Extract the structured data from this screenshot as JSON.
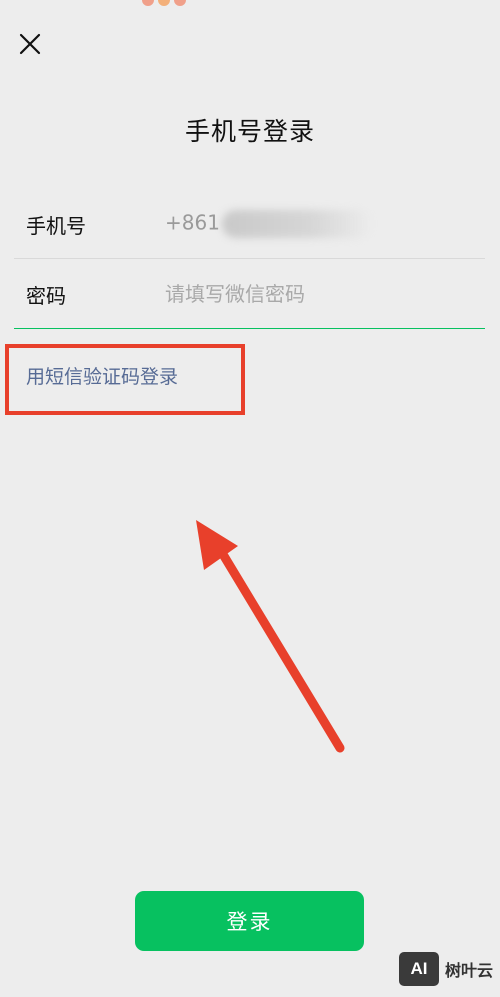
{
  "header": {
    "title": "手机号登录"
  },
  "form": {
    "phone_label": "手机号",
    "phone_value": "+861",
    "password_label": "密码",
    "password_placeholder": "请填写微信密码"
  },
  "links": {
    "sms_login": "用短信验证码登录"
  },
  "actions": {
    "login_label": "登录"
  },
  "watermark": {
    "logo_text": "AI",
    "brand": "树叶云"
  },
  "colors": {
    "accent_green": "#07c160",
    "link_blue": "#576b95",
    "annotation_red": "#e8402b",
    "background": "#ededed"
  },
  "icons": [
    "close-icon"
  ]
}
